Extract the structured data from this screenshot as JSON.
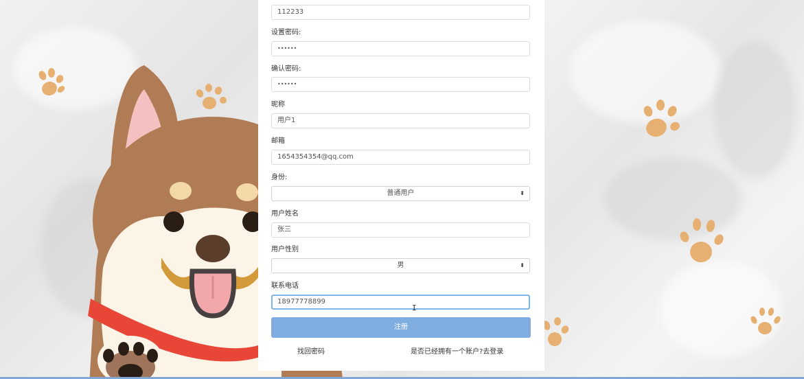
{
  "form": {
    "username_value": "112233",
    "password_label": "设置密码:",
    "password_value": "••••••",
    "confirm_label": "确认密码:",
    "confirm_value": "••••••",
    "nickname_label": "昵称",
    "nickname_value": "用户1",
    "email_label": "邮箱",
    "email_value": "1654354354@qq.com",
    "role_label": "身份:",
    "role_value": "普通用户",
    "realname_label": "用户姓名",
    "realname_value": "张三",
    "gender_label": "用户性别",
    "gender_value": "男",
    "phone_label": "联系电话",
    "phone_value": "18977778899",
    "submit_label": "注册"
  },
  "links": {
    "forgot_password": "找回密码",
    "go_login": "是否已经拥有一个账户?去登录"
  },
  "colors": {
    "accent": "#80ade0",
    "focus_border": "#80b4e6",
    "paw": "#e7b073",
    "dog_brown": "#b07c56"
  },
  "icons": {
    "select_caret": "⬍",
    "text_cursor": "I"
  }
}
